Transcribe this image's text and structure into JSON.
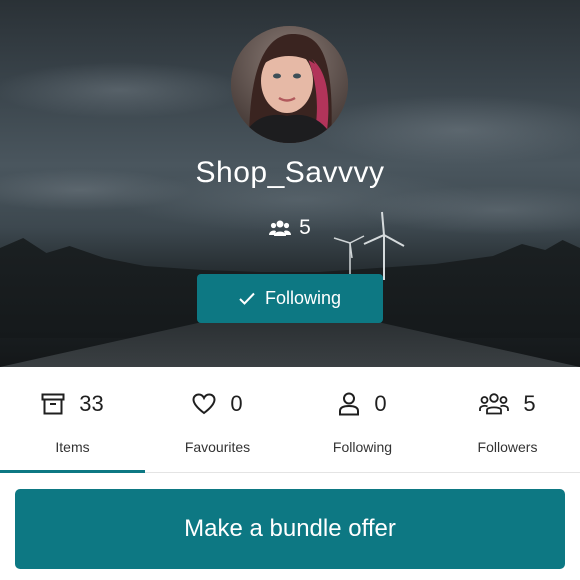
{
  "profile": {
    "shop_name": "Shop_Savvvy",
    "followers_count": "5",
    "follow_button_label": "Following"
  },
  "stats": [
    {
      "count": "33",
      "label": "Items",
      "icon": "archive-icon"
    },
    {
      "count": "0",
      "label": "Favourites",
      "icon": "heart-icon"
    },
    {
      "count": "0",
      "label": "Following",
      "icon": "user-icon"
    },
    {
      "count": "5",
      "label": "Followers",
      "icon": "users-icon"
    }
  ],
  "active_tab": "Items",
  "bundle_button_label": "Make a bundle offer",
  "colors": {
    "accent": "#0d7883",
    "background": "#ffffff"
  }
}
